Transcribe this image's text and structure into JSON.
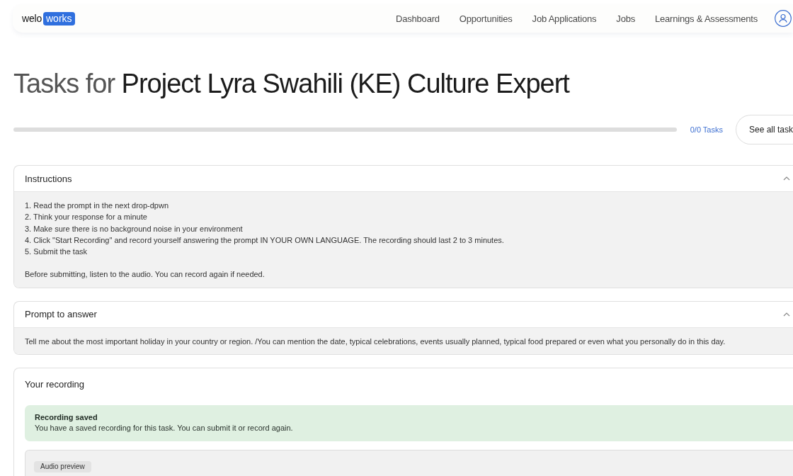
{
  "header": {
    "logo": {
      "word": "welo",
      "highlight": "works"
    },
    "nav": [
      {
        "label": "Dashboard",
        "selected": false
      },
      {
        "label": "Opportunities",
        "selected": false
      },
      {
        "label": "Job Applications",
        "selected": false
      },
      {
        "label": "Jobs",
        "selected": false
      },
      {
        "label": "Learnings & Assessments",
        "selected": false
      }
    ]
  },
  "title": {
    "prefix": "Tasks for",
    "project": "Project Lyra Swahili (KE) Culture Expert"
  },
  "progress": {
    "level": 0,
    "reading": "0/0 Tasks",
    "button": "See all task"
  },
  "sections": [
    {
      "kind": "text",
      "title": "Instructions",
      "expanded": true,
      "lines": [
        "1. Read the prompt in the next drop-dpwn",
        "2. Think your response for a minute",
        "3. Make sure there is no background noise in your environment",
        "4. Click \"Start Recording\" and record yourself answering the prompt IN YOUR OWN LANGUAGE. The recording should last 2 to 3 minutes.",
        "5. Submit the task"
      ],
      "note": "Before submitting, listen to the audio. You can record again if needed."
    },
    {
      "kind": "text",
      "title": "Prompt to answer",
      "expanded": true,
      "lines": [
        "Tell me about the most important holiday in your country or region. /You can mention the date, typical celebrations, events usually planned, typical food prepared or even what you personally do in this day."
      ]
    },
    {
      "kind": "recording",
      "title": "Your recording",
      "alert": {
        "title": "Recording saved",
        "message": "You have a saved recording for this task. You can submit it or record again."
      },
      "preview": {
        "label": "Audio preview"
      }
    }
  ]
}
